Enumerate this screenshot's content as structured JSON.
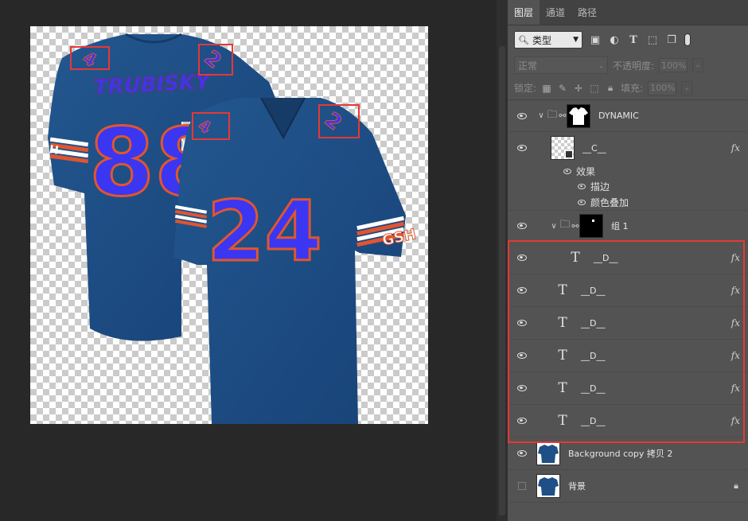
{
  "panel": {
    "tabs": [
      {
        "label": "图层",
        "active": true
      },
      {
        "label": "通道",
        "active": false
      },
      {
        "label": "路径",
        "active": false
      }
    ],
    "filter": {
      "label": "类型"
    },
    "blend_mode": "正常",
    "opacity_label": "不透明度:",
    "opacity_value": "100%",
    "lock_label": "锁定:",
    "fill_label": "填充:",
    "fill_value": "100%"
  },
  "layers": {
    "dynamic": {
      "name": "DYNAMIC"
    },
    "c_layer": {
      "name": "__C__",
      "fx": "fx"
    },
    "effects_label": "效果",
    "effect_stroke": "描边",
    "effect_color_overlay": "颜色叠加",
    "group1": {
      "name": "组 1"
    },
    "d_layers": [
      {
        "name": "__D__",
        "glyph": "T",
        "fx": "fx"
      },
      {
        "name": "__D__",
        "glyph": "T",
        "fx": "fx"
      },
      {
        "name": "__D__",
        "glyph": "T",
        "fx": "fx"
      },
      {
        "name": "__D__",
        "glyph": "T",
        "fx": "fx"
      },
      {
        "name": "__D__",
        "glyph": "T",
        "fx": "fx"
      },
      {
        "name": "__D__",
        "glyph": "T",
        "fx": "fx"
      }
    ],
    "background_copy": {
      "name": "Background copy 拷贝  2"
    },
    "background": {
      "name": "背景"
    }
  },
  "canvas": {
    "back_name": "TRUBISKY",
    "back_number": "88",
    "front_number": "24",
    "sleeve_text": "GSH",
    "colors": {
      "jersey": "#1e4f86",
      "number": "#3b36f2",
      "outline": "#e0552f",
      "selection": "#e53935"
    }
  }
}
